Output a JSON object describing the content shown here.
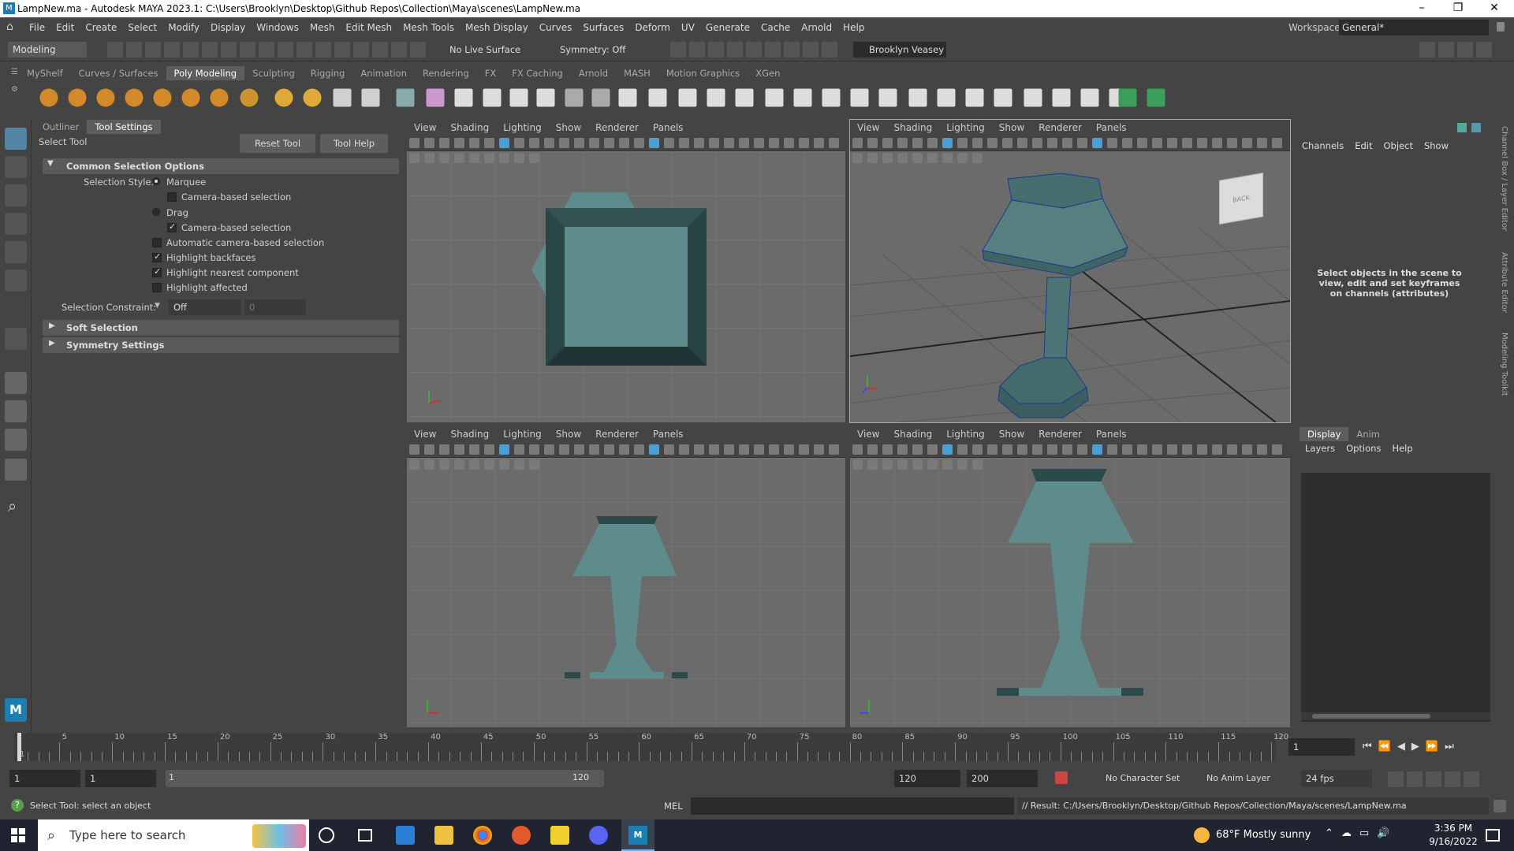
{
  "window": {
    "title": "LampNew.ma - Autodesk MAYA 2023.1: C:\\Users\\Brooklyn\\Desktop\\Github Repos\\Collection\\Maya\\scenes\\LampNew.ma",
    "minimize": "–",
    "maximize": "❐",
    "close": "✕"
  },
  "menu": [
    "File",
    "Edit",
    "Create",
    "Select",
    "Modify",
    "Display",
    "Windows",
    "Mesh",
    "Edit Mesh",
    "Mesh Tools",
    "Mesh Display",
    "Curves",
    "Surfaces",
    "Deform",
    "UV",
    "Generate",
    "Cache",
    "Arnold",
    "Help"
  ],
  "workspace": {
    "label": "Workspace:",
    "value": "General*"
  },
  "statusline": {
    "menuset": "Modeling",
    "live_surface": "No Live Surface",
    "symmetry": "Symmetry: Off",
    "user": "Brooklyn Veasey"
  },
  "shelf_tabs": [
    "MyShelf",
    "Curves / Surfaces",
    "Poly Modeling",
    "Sculpting",
    "Rigging",
    "Animation",
    "Rendering",
    "FX",
    "FX Caching",
    "Arnold",
    "MASH",
    "Motion Graphics",
    "XGen"
  ],
  "shelf_active": "Poly Modeling",
  "panel": {
    "tabs": [
      "Outliner",
      "Tool Settings"
    ],
    "tool_name": "Select Tool",
    "reset_tool": "Reset Tool",
    "tool_help": "Tool Help",
    "common_section": "Common Selection Options",
    "selection_style_label": "Selection Style:",
    "marquee": "Marquee",
    "camera_based_1": "Camera-based selection",
    "drag": "Drag",
    "camera_based_2": "Camera-based selection",
    "auto_camera": "Automatic camera-based selection",
    "highlight_backfaces": "Highlight backfaces",
    "highlight_nearest": "Highlight nearest component",
    "highlight_affected": "Highlight affected",
    "constraint_label": "Selection Constraint:",
    "constraint_value": "Off",
    "constraint_num": "0",
    "soft_selection": "Soft Selection",
    "symmetry_settings": "Symmetry Settings"
  },
  "viewport_menu": [
    "View",
    "Shading",
    "Lighting",
    "Show",
    "Renderer",
    "Panels"
  ],
  "viewcube_label": "BACK",
  "channelbox": {
    "menu": [
      "Channels",
      "Edit",
      "Object",
      "Show"
    ],
    "message": "Select objects in the scene to view, edit and set keyframes on channels (attributes)",
    "layer_tabs": [
      "Display",
      "Anim"
    ],
    "layer_menu": [
      "Layers",
      "Options",
      "Help"
    ],
    "side_tabs": [
      "Channel Box / Layer Editor",
      "Attribute Editor",
      "Modeling Toolkit"
    ]
  },
  "timeline": {
    "ticks": [
      "1",
      "5",
      "10",
      "15",
      "20",
      "25",
      "30",
      "35",
      "40",
      "45",
      "50",
      "55",
      "60",
      "65",
      "70",
      "75",
      "80",
      "85",
      "90",
      "95",
      "100",
      "105",
      "110",
      "115",
      "120"
    ],
    "current": "1"
  },
  "range": {
    "start": "1",
    "start2": "1",
    "slider_start": "1",
    "slider_end": "120",
    "end": "120",
    "end2": "200",
    "char_set": "No Character Set",
    "anim_layer": "No Anim Layer",
    "fps": "24 fps"
  },
  "helpline": {
    "text": "Select Tool: select an object",
    "mel": "MEL",
    "result": "// Result: C:/Users/Brooklyn/Desktop/Github Repos/Collection/Maya/scenes/LampNew.ma"
  },
  "taskbar": {
    "search": "Type here to search",
    "weather": "68°F  Mostly sunny",
    "time": "3:36 PM",
    "date": "9/16/2022"
  },
  "logo_text": "M"
}
